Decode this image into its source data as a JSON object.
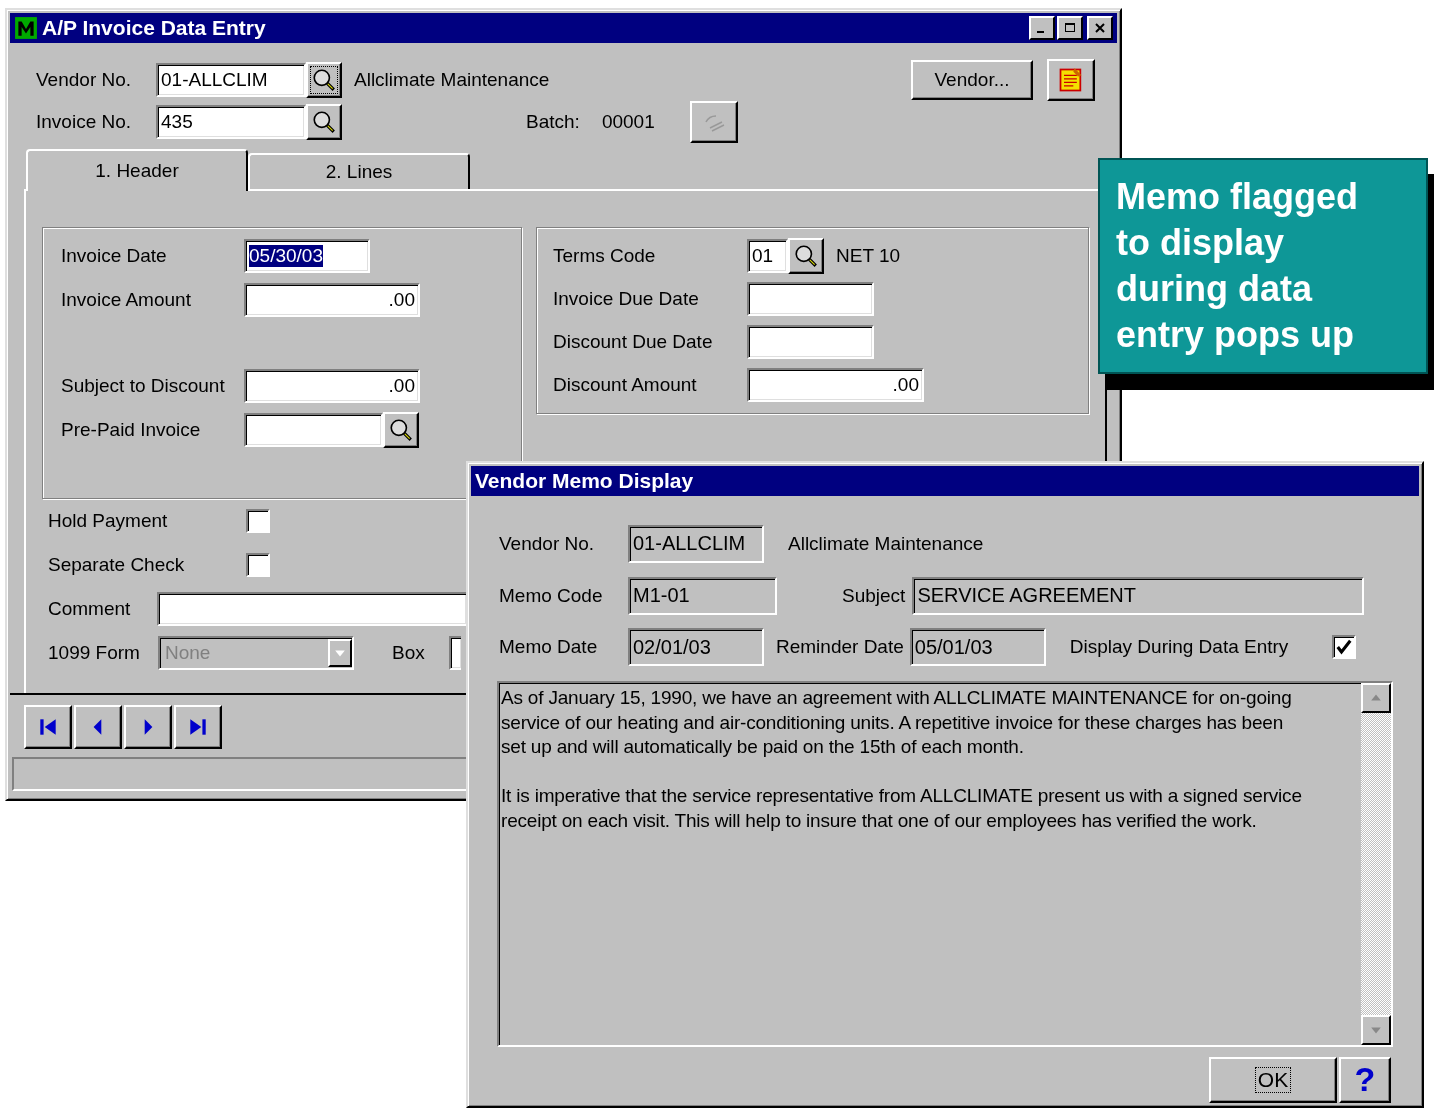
{
  "main_window": {
    "title": "A/P Invoice Data Entry",
    "vendor_no": {
      "label": "Vendor No.",
      "value": "01-ALLCLIM",
      "name": "Allclimate Maintenance"
    },
    "invoice_no": {
      "label": "Invoice No.",
      "value": "435"
    },
    "batch": {
      "label": "Batch:",
      "value": "00001"
    },
    "vendor_button": "Vendor...",
    "tabs": [
      {
        "label": "1. Header",
        "selected": true
      },
      {
        "label": "2. Lines",
        "selected": false
      }
    ],
    "left_fields": [
      {
        "label": "Invoice Date",
        "value": "05/30/03",
        "kind": "date",
        "selected": true
      },
      {
        "label": "Invoice Amount",
        "value": ".00",
        "kind": "amount",
        "selected": false
      },
      {
        "label": "Subject to Discount",
        "value": ".00",
        "kind": "amount",
        "selected": false
      },
      {
        "label": "Pre-Paid Invoice",
        "kind": "lookup",
        "selected": false
      }
    ],
    "right_fields": [
      {
        "label": "Terms Code",
        "value": "01",
        "description": "NET 10",
        "kind": "code"
      },
      {
        "label": "Invoice Due Date",
        "kind": "date"
      },
      {
        "label": "Discount Due Date",
        "kind": "date"
      },
      {
        "label": "Discount Amount",
        "value": ".00",
        "kind": "amount"
      }
    ],
    "checkboxes": [
      {
        "label": "Hold Payment",
        "checked": false
      },
      {
        "label": "Separate Check",
        "checked": false
      }
    ],
    "comment": {
      "label": "Comment"
    },
    "form_1099": {
      "label": "1099 Form",
      "value": "None",
      "disabled": true
    },
    "box": {
      "label": "Box"
    }
  },
  "memo_window": {
    "title": "Vendor Memo Display",
    "vendor_no": {
      "label": "Vendor No.",
      "value": "01-ALLCLIM",
      "name": "Allclimate Maintenance"
    },
    "memo_code": {
      "label": "Memo Code",
      "value": "M1-01"
    },
    "subject": {
      "label": "Subject",
      "value": "SERVICE AGREEMENT"
    },
    "memo_date": {
      "label": "Memo Date",
      "value": "02/01/03"
    },
    "reminder_date": {
      "label": "Reminder Date",
      "value": "05/01/03"
    },
    "display_during_entry": {
      "label": "Display During Data Entry",
      "checked": true
    },
    "memo_text": [
      [
        "As of January 15, 1990, we have an agreement with ALLCLIMATE MAINTENANCE for on-going",
        "service of our heating and air-conditioning units.  A repetitive invoice for these charges has been",
        "set up and will automatically be paid on the 15th of each month."
      ],
      [
        "It is imperative that the service representative from ALLCLIMATE present us with a signed service",
        "receipt on each visit.  This will help to insure that one of our employees has verified the work."
      ]
    ],
    "ok_button": "OK",
    "help_button": "?"
  },
  "callout": {
    "lines": [
      "Memo flagged",
      "to display",
      "during data",
      "entry pops up"
    ]
  }
}
